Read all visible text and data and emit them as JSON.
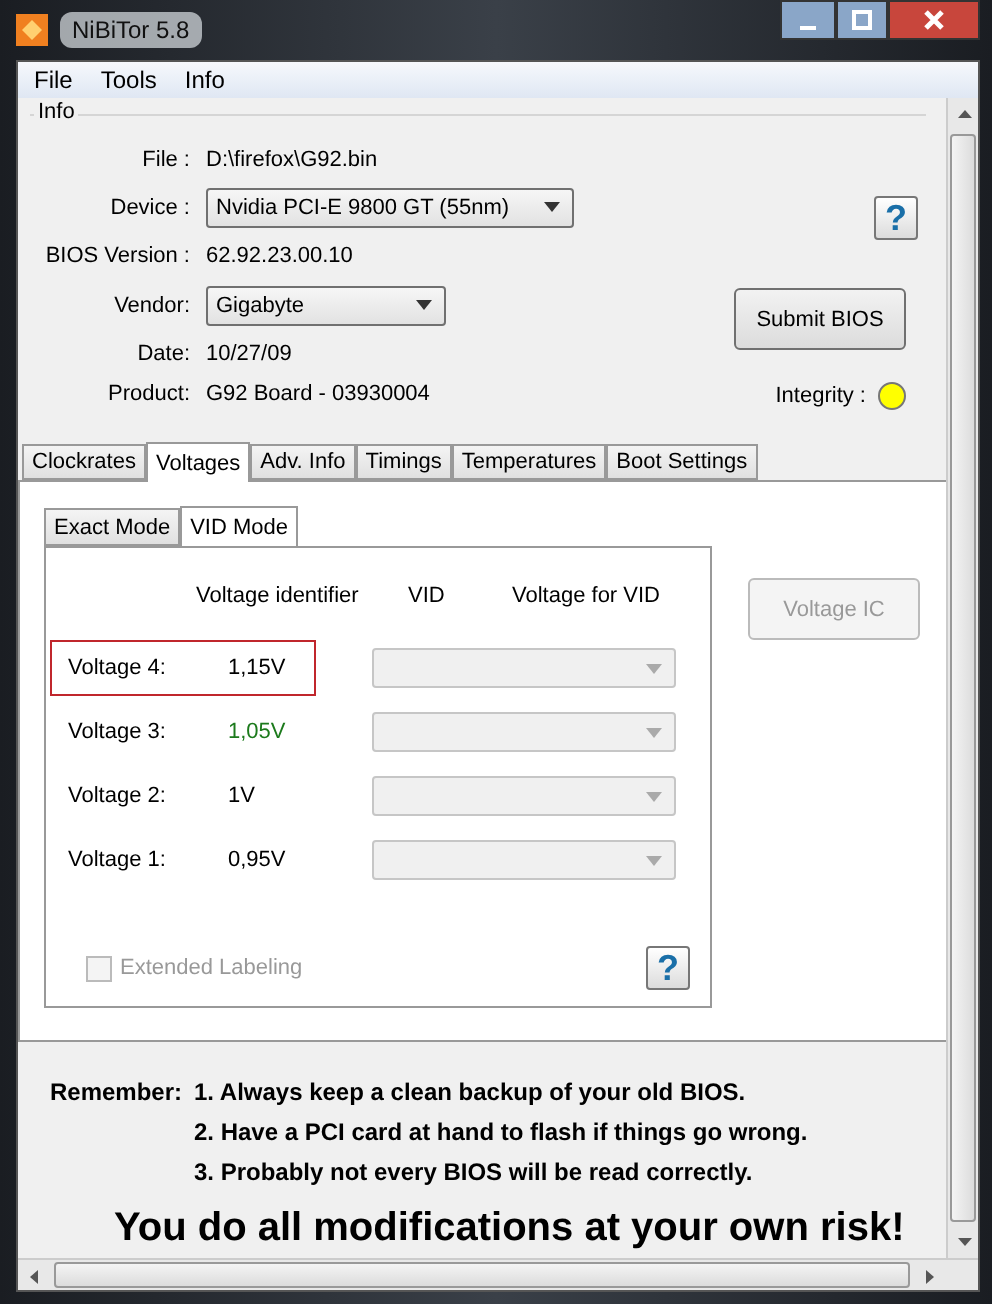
{
  "window": {
    "title": "NiBiTor 5.8"
  },
  "menu": [
    "File",
    "Tools",
    "Info"
  ],
  "info": {
    "legend": "Info",
    "fields": [
      {
        "label": "File :",
        "value": "D:\\firefox\\G92.bin",
        "kind": "text"
      },
      {
        "label": "Device :",
        "value": "Nvidia PCI-E 9800 GT (55nm)",
        "kind": "select"
      },
      {
        "label": "BIOS Version :",
        "value": "62.92.23.00.10",
        "kind": "text"
      },
      {
        "label": "Vendor:",
        "value": "Gigabyte",
        "kind": "select"
      },
      {
        "label": "Date:",
        "value": "10/27/09",
        "kind": "text"
      },
      {
        "label": "Product:",
        "value": "G92 Board - 03930004",
        "kind": "text"
      }
    ],
    "help": "?",
    "submit": "Submit BIOS",
    "integrity": {
      "label": "Integrity :",
      "color": "#ffff00"
    }
  },
  "tabs": [
    {
      "label": "Clockrates",
      "selected": false
    },
    {
      "label": "Voltages",
      "selected": true
    },
    {
      "label": "Adv. Info",
      "selected": false
    },
    {
      "label": "Timings",
      "selected": false
    },
    {
      "label": "Temperatures",
      "selected": false
    },
    {
      "label": "Boot Settings",
      "selected": false
    }
  ],
  "subtabs": [
    {
      "label": "Exact Mode",
      "selected": false
    },
    {
      "label": "VID Mode",
      "selected": true
    }
  ],
  "columns": [
    "Voltage identifier",
    "VID",
    "Voltage for VID"
  ],
  "voltages": [
    {
      "label": "Voltage 4:",
      "value": "1,15V",
      "highlighted": true,
      "color": "#000000",
      "vid_disabled": true
    },
    {
      "label": "Voltage 3:",
      "value": "1,05V",
      "highlighted": false,
      "color": "#1c7a1c",
      "vid_disabled": true
    },
    {
      "label": "Voltage 2:",
      "value": "1V",
      "highlighted": false,
      "color": "#000000",
      "vid_disabled": true
    },
    {
      "label": "Voltage 1:",
      "value": "0,95V",
      "highlighted": false,
      "color": "#000000",
      "vid_disabled": true
    }
  ],
  "extended_labeling": {
    "label": "Extended Labeling",
    "checked": false,
    "disabled": true
  },
  "panel_help": "?",
  "voltage_ic": {
    "label": "Voltage IC",
    "disabled": true
  },
  "remember": {
    "label": "Remember:",
    "items": [
      "1. Always keep a clean backup of your old BIOS.",
      "2. Have a PCI card at hand to flash if things go wrong.",
      "3. Probably not every BIOS will be read correctly."
    ]
  },
  "warning": "You do all modifications at your own risk!"
}
